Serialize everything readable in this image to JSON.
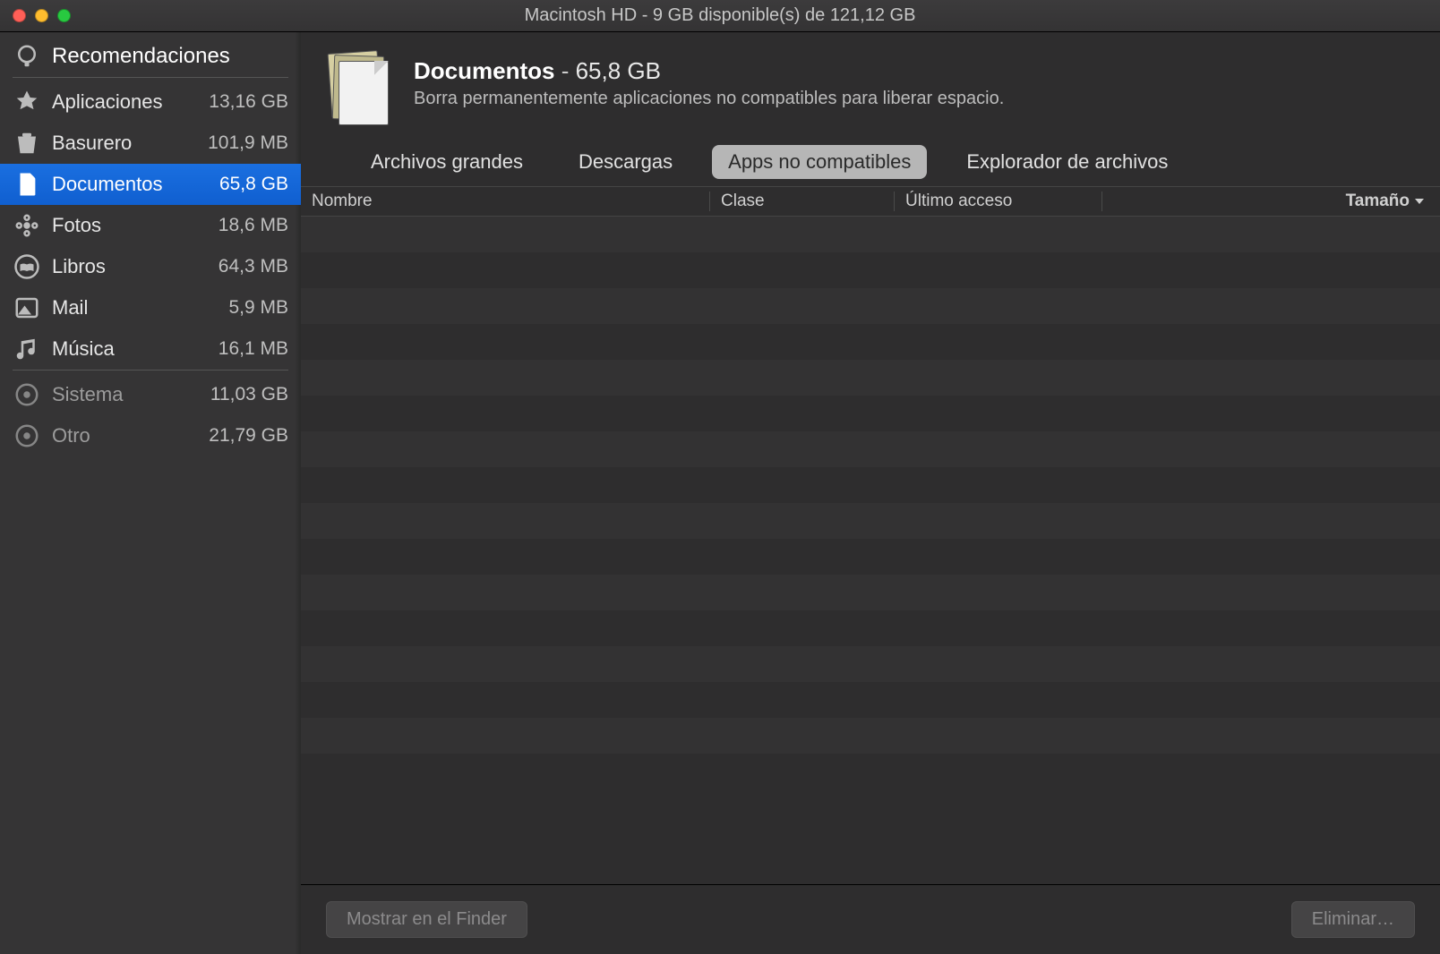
{
  "window": {
    "title": "Macintosh HD - 9 GB disponible(s) de 121,12 GB"
  },
  "sidebar": {
    "items": [
      {
        "label": "Recomendaciones",
        "size": ""
      },
      {
        "label": "Aplicaciones",
        "size": "13,16 GB"
      },
      {
        "label": "Basurero",
        "size": "101,9 MB"
      },
      {
        "label": "Documentos",
        "size": "65,8 GB"
      },
      {
        "label": "Fotos",
        "size": "18,6 MB"
      },
      {
        "label": "Libros",
        "size": "64,3 MB"
      },
      {
        "label": "Mail",
        "size": "5,9 MB"
      },
      {
        "label": "Música",
        "size": "16,1 MB"
      },
      {
        "label": "Sistema",
        "size": "11,03 GB"
      },
      {
        "label": "Otro",
        "size": "21,79 GB"
      }
    ]
  },
  "header": {
    "title": "Documentos",
    "dash": " - ",
    "size": "65,8 GB",
    "subtitle": "Borra permanentemente aplicaciones no compatibles para liberar espacio."
  },
  "tabs": [
    {
      "label": "Archivos grandes"
    },
    {
      "label": "Descargas"
    },
    {
      "label": "Apps no compatibles"
    },
    {
      "label": "Explorador de archivos"
    }
  ],
  "columns": {
    "nombre": "Nombre",
    "clase": "Clase",
    "ultimo": "Último acceso",
    "tamano": "Tamaño"
  },
  "footer": {
    "show_in_finder": "Mostrar en el Finder",
    "delete": "Eliminar…"
  },
  "row_count": 15
}
